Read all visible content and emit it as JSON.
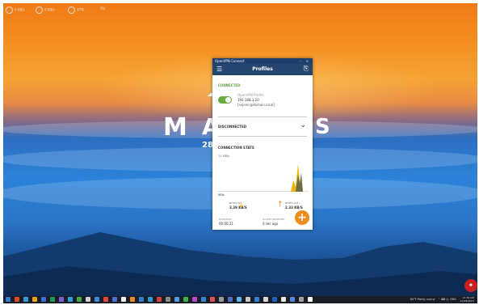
{
  "desktop": {
    "widgets": [
      {
        "value": "0 KB/s",
        "sub": "UPLOAD"
      },
      {
        "value": "0 KB/s",
        "sub": "DOWNLOAD"
      },
      {
        "value": "37%",
        "sub": "RAM"
      },
      {
        "value": "5%",
        "sub": "CPU"
      }
    ],
    "brand_letters": [
      "M",
      "A",
      "S"
    ],
    "date_day": "28"
  },
  "vpn": {
    "window_title": "OpenVPN Connect",
    "header_title": "Profiles",
    "connected_label": "CONNECTED",
    "profile": {
      "name": "OpenVPN Profile",
      "ip": "192.168.1.10",
      "user": "[sejonir@domain.local]"
    },
    "disconnected_label": "DISCONNECTED",
    "stats_label": "CONNECTION STATS",
    "chart_scale_top": "11 MB/s",
    "chart_scale_bottom": "0B/s",
    "bytes_in_label": "BYTES IN",
    "bytes_in_value": "3.39 KB/S",
    "bytes_out_label": "BYTES OUT",
    "bytes_out_value": "2.33 KB/S",
    "duration_label": "DURATION",
    "duration_value": "00:00:11",
    "packet_label": "PACKET RECEIVED",
    "packet_value": "0 sec ago",
    "colors": {
      "header": "#24466f",
      "connected": "#5aa33a",
      "accent": "#f08c1e",
      "in_arrow": "#f2a900"
    }
  },
  "taskbar": {
    "weather": "60°F Partly sunny",
    "time": "11:56 AM",
    "date": "11/28/2021",
    "lang": "ENG"
  }
}
